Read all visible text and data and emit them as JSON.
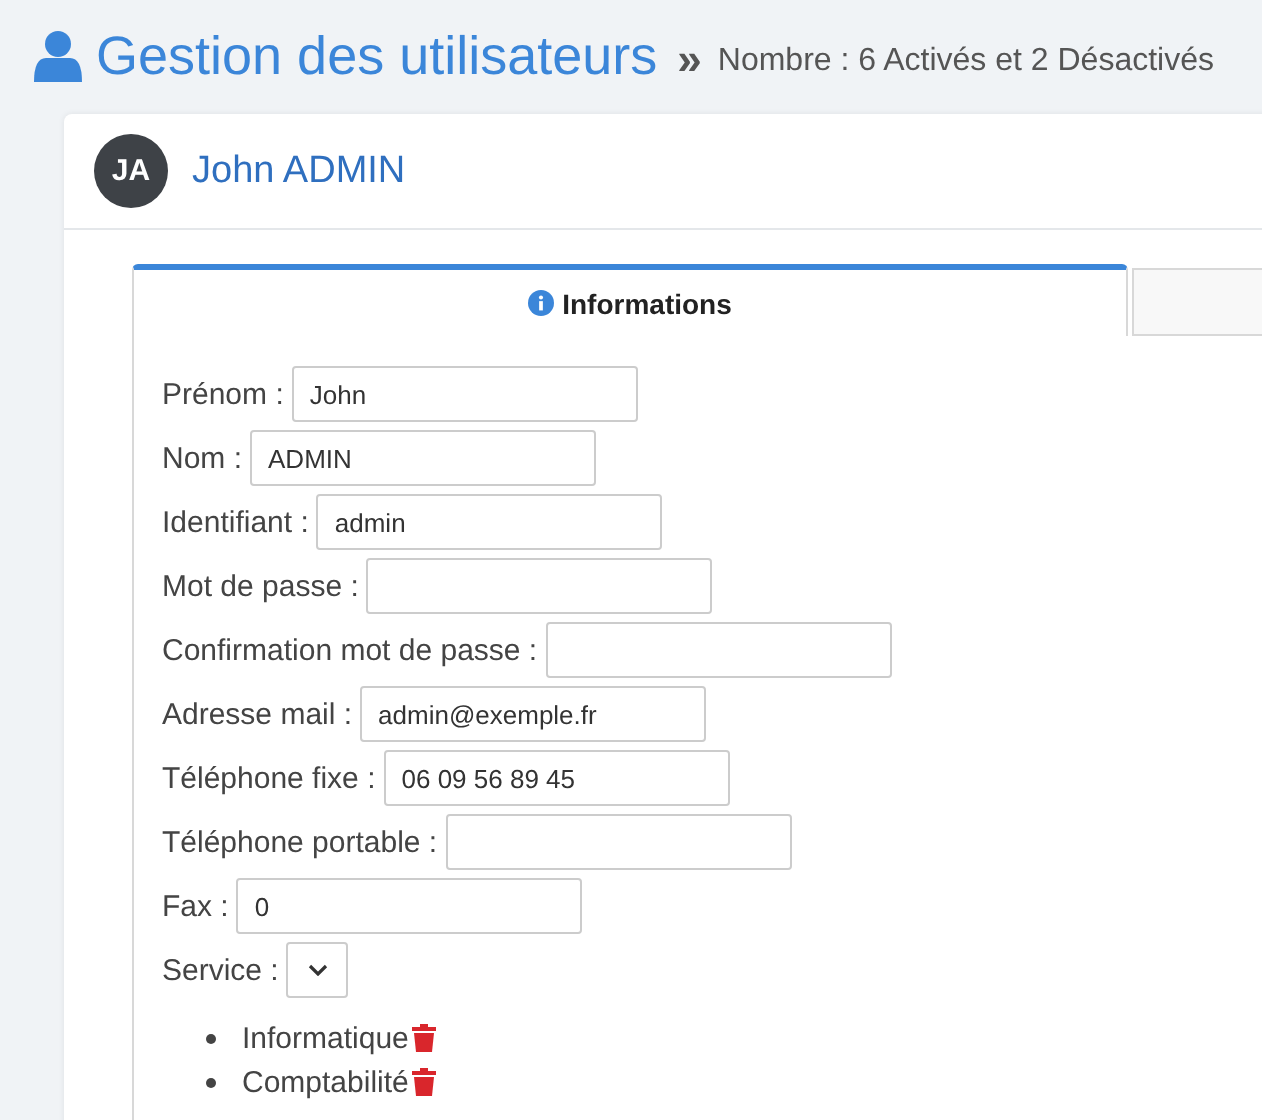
{
  "header": {
    "title": "Gestion des utilisateurs",
    "separator": "»",
    "summary": "Nombre : 6 Activés et 2 Désactivés"
  },
  "card": {
    "avatar_initials": "JA",
    "user_name": "John ADMIN"
  },
  "tabs": [
    {
      "label": "Informations",
      "selected": true
    },
    {
      "selected": false
    }
  ],
  "form": [
    {
      "kind": "text",
      "label": "Prénom :",
      "value": "John"
    },
    {
      "kind": "text",
      "label": "Nom :",
      "value": "ADMIN"
    },
    {
      "kind": "text",
      "label": "Identifiant :",
      "value": "admin"
    },
    {
      "kind": "text",
      "label": "Mot de passe :"
    },
    {
      "kind": "text",
      "label": "Confirmation mot de passe :"
    },
    {
      "kind": "text",
      "label": "Adresse mail :",
      "value": "admin@exemple.fr"
    },
    {
      "kind": "text",
      "label": "Téléphone fixe :",
      "value": "06 09 56 89 45"
    },
    {
      "kind": "text",
      "label": "Téléphone portable :"
    },
    {
      "kind": "text",
      "label": "Fax :",
      "value": "0"
    },
    {
      "kind": "select",
      "label": "Service :"
    }
  ],
  "services": [
    "Informatique",
    "Comptabilité"
  ]
}
